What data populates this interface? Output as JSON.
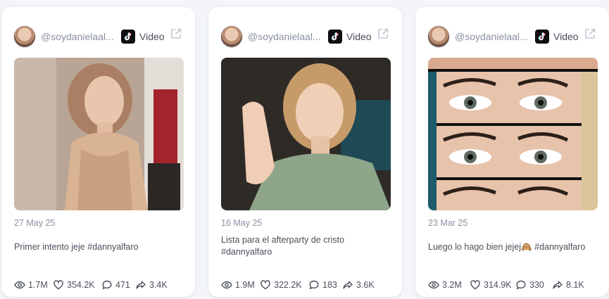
{
  "cards": [
    {
      "handle": "@soydanielaal...",
      "platform": "Video",
      "date": "27 May 25",
      "caption": "Primer intento jeje #dannyalfaro",
      "views": "1.7M",
      "likes": "354.2K",
      "comments": "471",
      "shares": "3.4K"
    },
    {
      "handle": "@soydanielaal...",
      "platform": "Video",
      "date": "16 May 25",
      "caption": "Lista para el afterparty de cristo #dannyalfaro",
      "views": "1.9M",
      "likes": "322.2K",
      "comments": "183",
      "shares": "3.6K"
    },
    {
      "handle": "@soydanielaal...",
      "platform": "Video",
      "date": "23 Mar 25",
      "caption": "Luego lo hago bien jejej🙈 #dannyalfaro",
      "views": "3.2M",
      "likes": "314.9K",
      "comments": "330",
      "shares": "8.1K"
    }
  ],
  "icons": {
    "platform": "tiktok-icon",
    "external": "external-link-icon",
    "views": "eye-icon",
    "likes": "heart-icon",
    "comments": "comment-icon",
    "shares": "share-icon"
  }
}
